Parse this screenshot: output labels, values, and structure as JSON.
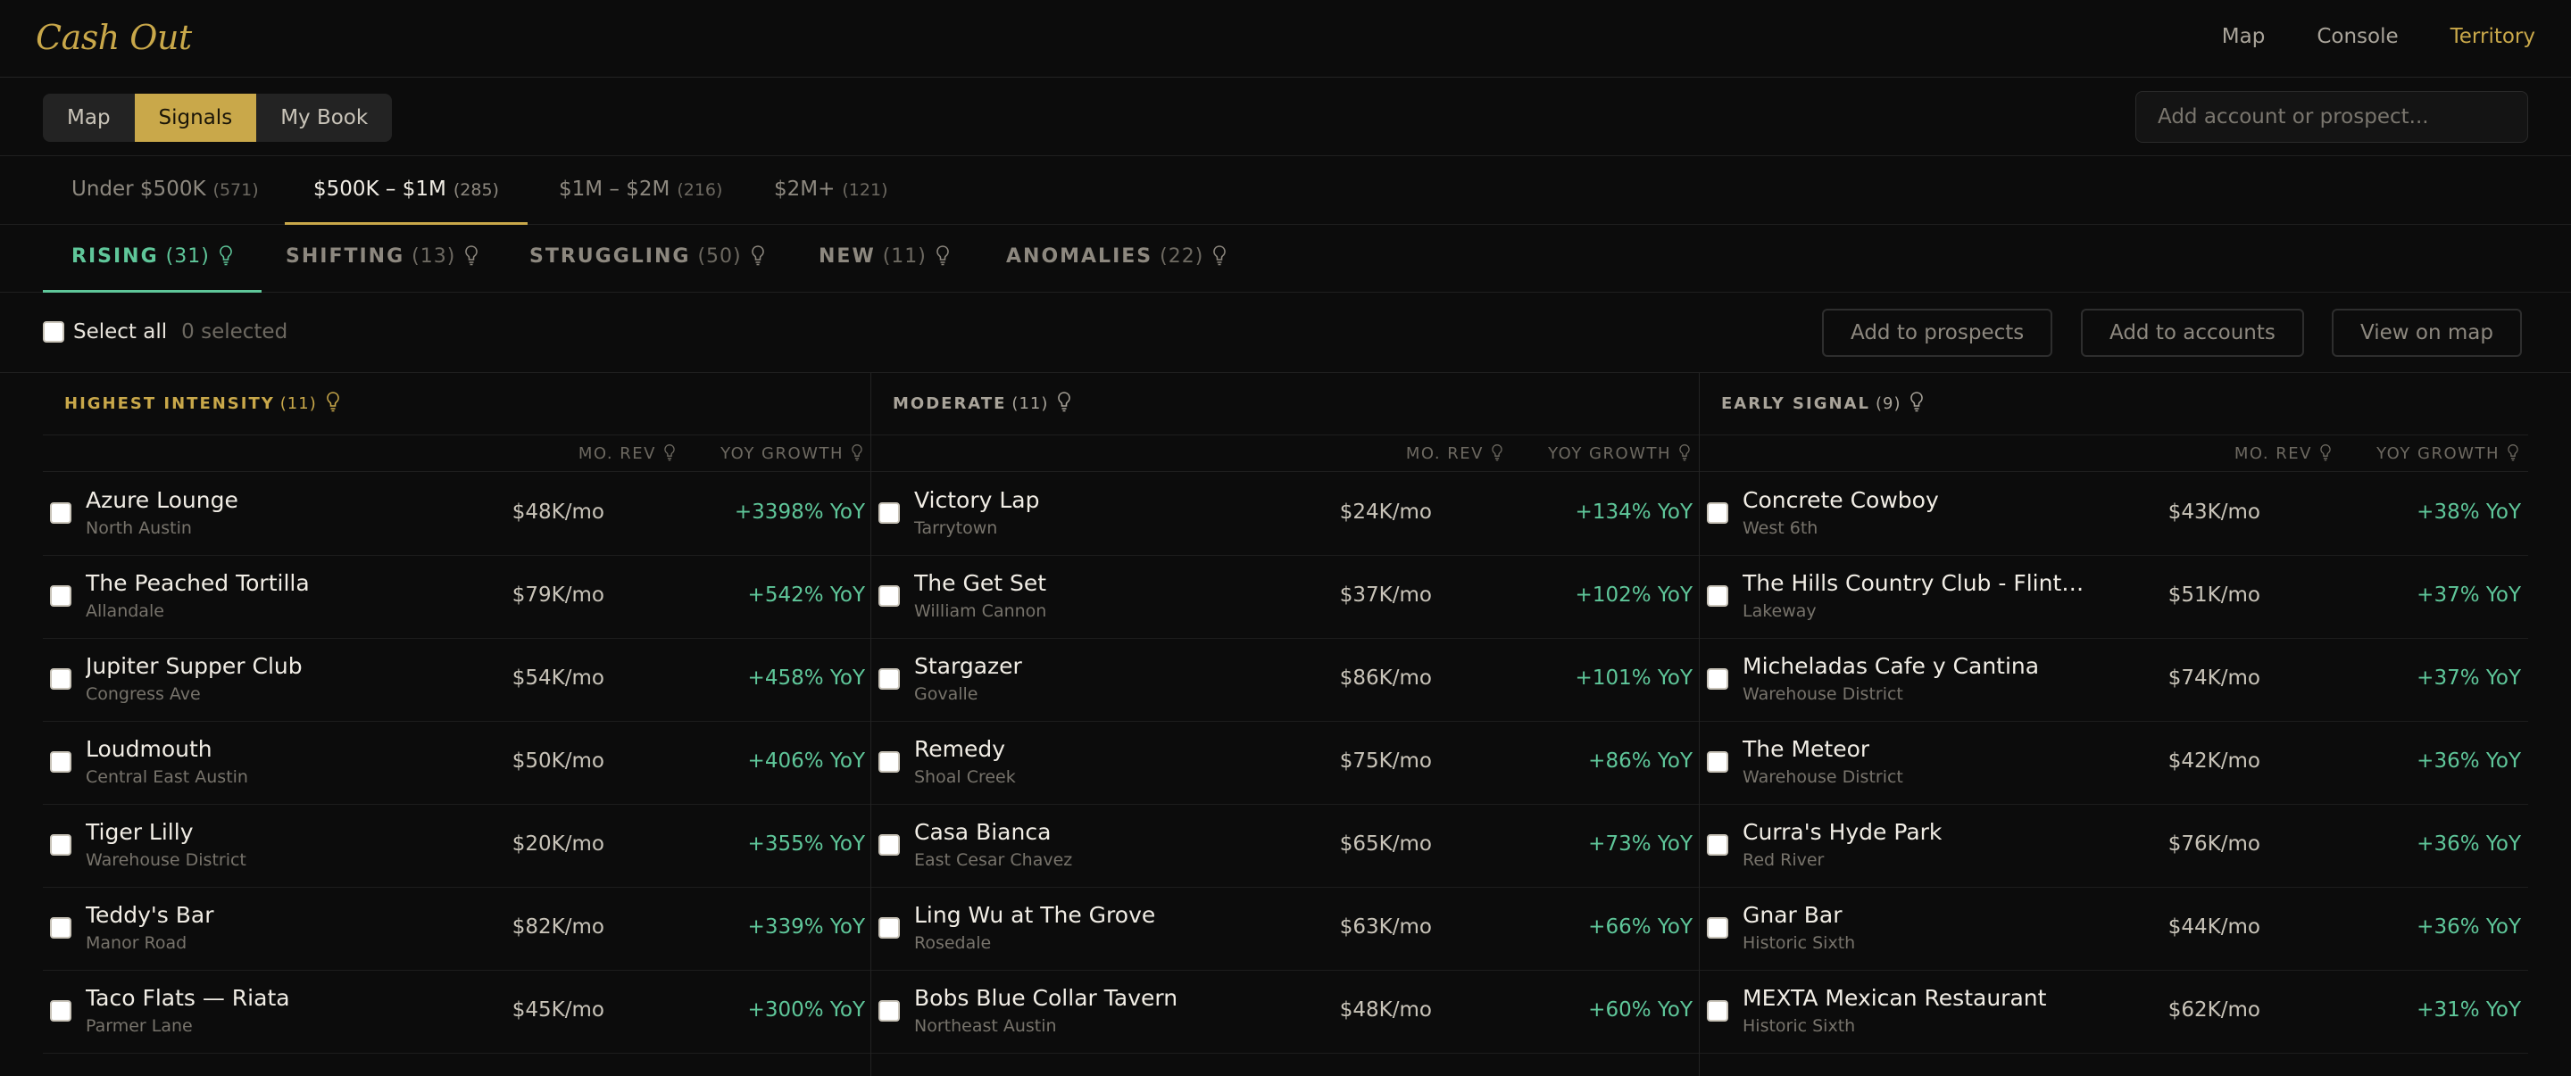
{
  "app": {
    "title": "Cash Out"
  },
  "topnav": [
    "Map",
    "Console",
    "Territory"
  ],
  "view_toggle": [
    "Map",
    "Signals",
    "My Book"
  ],
  "search": {
    "placeholder": "Add account or prospect..."
  },
  "revenue_tabs": [
    {
      "label": "Under $500K",
      "count": "(571)"
    },
    {
      "label": "$500K – $1M",
      "count": "(285)"
    },
    {
      "label": "$1M – $2M",
      "count": "(216)"
    },
    {
      "label": "$2M+",
      "count": "(121)"
    }
  ],
  "signal_tabs": [
    {
      "label": "RISING",
      "count": "(31)"
    },
    {
      "label": "SHIFTING",
      "count": "(13)"
    },
    {
      "label": "STRUGGLING",
      "count": "(50)"
    },
    {
      "label": "NEW",
      "count": "(11)"
    },
    {
      "label": "ANOMALIES",
      "count": "(22)"
    }
  ],
  "actions": {
    "select_all": "Select all",
    "selected": "0 selected",
    "buttons": [
      "Add to prospects",
      "Add to accounts",
      "View on map"
    ]
  },
  "table_headers": {
    "rev": "MO. REV",
    "yoy": "YOY GROWTH"
  },
  "columns": [
    {
      "title": "HIGHEST INTENSITY",
      "count": "(11)",
      "rows": [
        {
          "name": "Azure Lounge",
          "loc": "North Austin",
          "rev": "$48K/mo",
          "yoy": "+3398% YoY"
        },
        {
          "name": "The Peached Tortilla",
          "loc": "Allandale",
          "rev": "$79K/mo",
          "yoy": "+542% YoY"
        },
        {
          "name": "Jupiter Supper Club",
          "loc": "Congress Ave",
          "rev": "$54K/mo",
          "yoy": "+458% YoY"
        },
        {
          "name": "Loudmouth",
          "loc": "Central East Austin",
          "rev": "$50K/mo",
          "yoy": "+406% YoY"
        },
        {
          "name": "Tiger Lilly",
          "loc": "Warehouse District",
          "rev": "$20K/mo",
          "yoy": "+355% YoY"
        },
        {
          "name": "Teddy's Bar",
          "loc": "Manor Road",
          "rev": "$82K/mo",
          "yoy": "+339% YoY"
        },
        {
          "name": "Taco Flats — Riata",
          "loc": "Parmer Lane",
          "rev": "$45K/mo",
          "yoy": "+300% YoY"
        }
      ]
    },
    {
      "title": "MODERATE",
      "count": "(11)",
      "rows": [
        {
          "name": "Victory Lap",
          "loc": "Tarrytown",
          "rev": "$24K/mo",
          "yoy": "+134% YoY"
        },
        {
          "name": "The Get Set",
          "loc": "William Cannon",
          "rev": "$37K/mo",
          "yoy": "+102% YoY"
        },
        {
          "name": "Stargazer",
          "loc": "Govalle",
          "rev": "$86K/mo",
          "yoy": "+101% YoY"
        },
        {
          "name": "Remedy",
          "loc": "Shoal Creek",
          "rev": "$75K/mo",
          "yoy": "+86% YoY"
        },
        {
          "name": "Casa Bianca",
          "loc": "East Cesar Chavez",
          "rev": "$65K/mo",
          "yoy": "+73% YoY"
        },
        {
          "name": "Ling Wu at The Grove",
          "loc": "Rosedale",
          "rev": "$63K/mo",
          "yoy": "+66% YoY"
        },
        {
          "name": "Bobs Blue Collar Tavern",
          "loc": "Northeast Austin",
          "rev": "$48K/mo",
          "yoy": "+60% YoY"
        }
      ]
    },
    {
      "title": "EARLY SIGNAL",
      "count": "(9)",
      "rows": [
        {
          "name": "Concrete Cowboy",
          "loc": "West 6th",
          "rev": "$43K/mo",
          "yoy": "+38% YoY"
        },
        {
          "name": "The Hills Country Club - Flintro...",
          "loc": "Lakeway",
          "rev": "$51K/mo",
          "yoy": "+37% YoY"
        },
        {
          "name": "Micheladas Cafe y Cantina",
          "loc": "Warehouse District",
          "rev": "$74K/mo",
          "yoy": "+37% YoY"
        },
        {
          "name": "The Meteor",
          "loc": "Warehouse District",
          "rev": "$42K/mo",
          "yoy": "+36% YoY"
        },
        {
          "name": "Curra's Hyde Park",
          "loc": "Red River",
          "rev": "$76K/mo",
          "yoy": "+36% YoY"
        },
        {
          "name": "Gnar Bar",
          "loc": "Historic Sixth",
          "rev": "$44K/mo",
          "yoy": "+36% YoY"
        },
        {
          "name": "MEXTA Mexican Restaurant",
          "loc": "Historic Sixth",
          "rev": "$62K/mo",
          "yoy": "+31% YoY"
        }
      ]
    }
  ]
}
